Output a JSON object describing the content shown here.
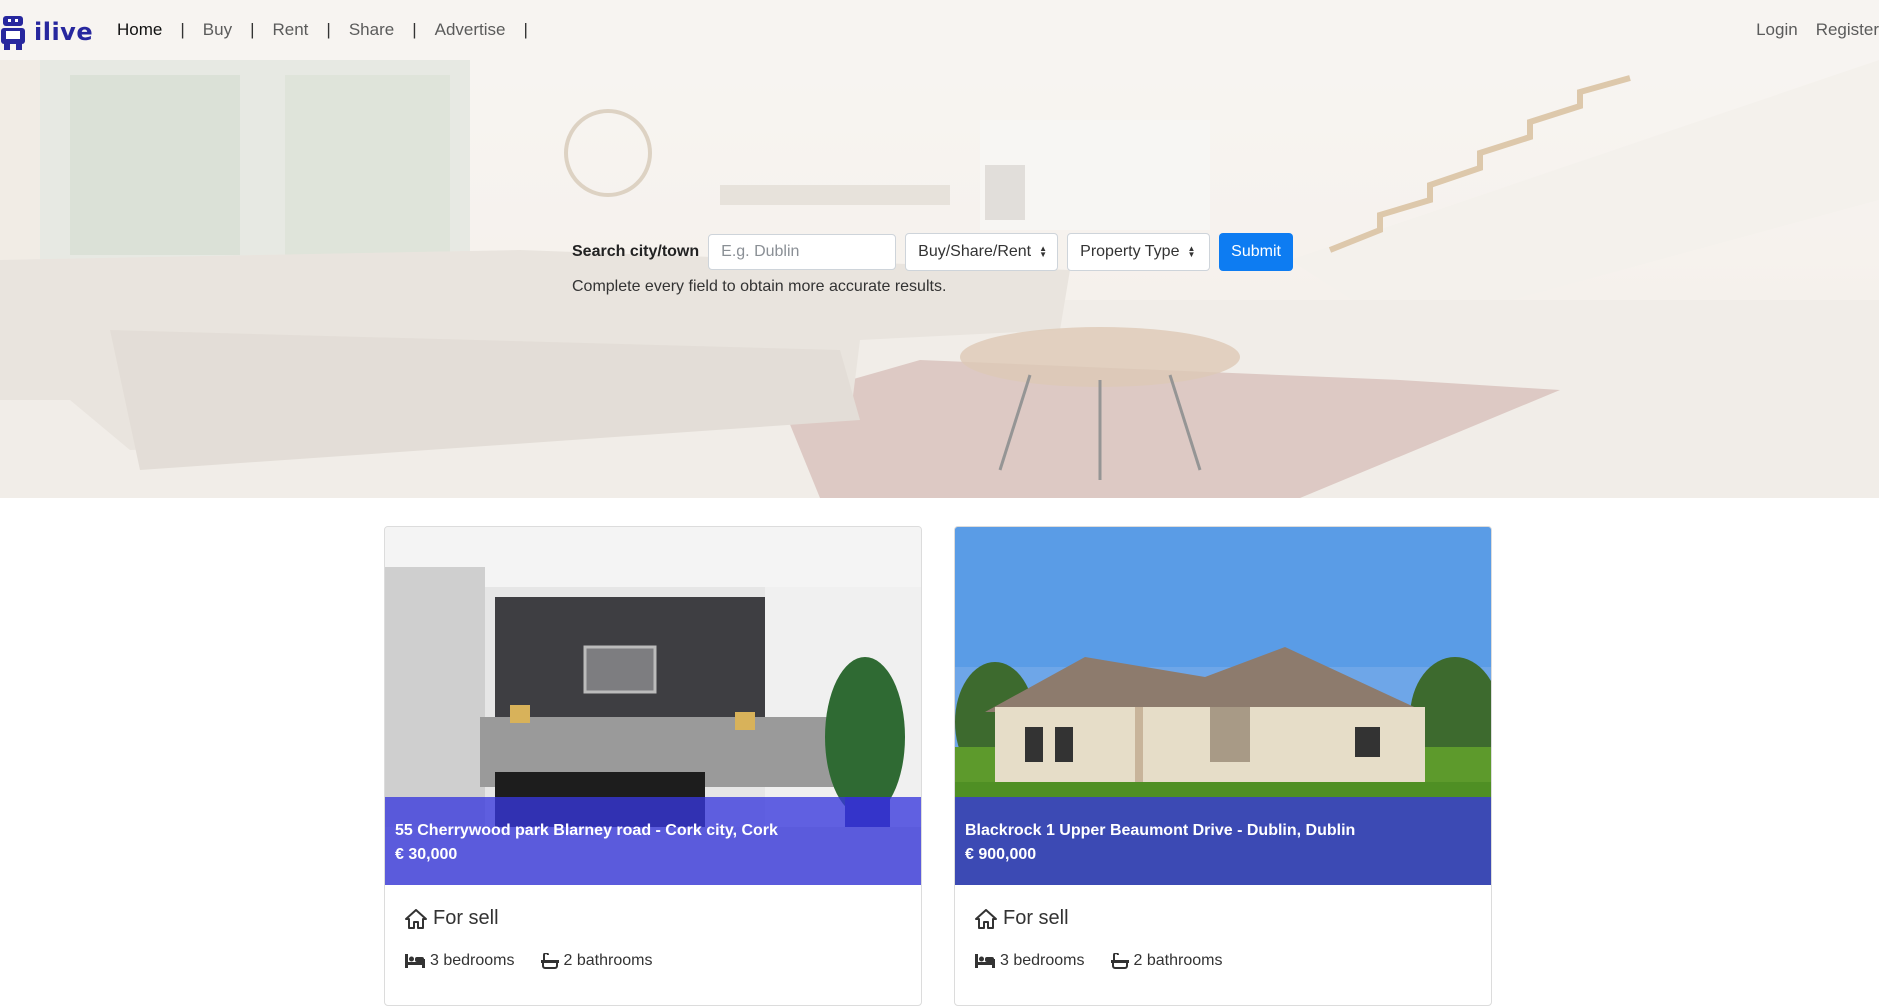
{
  "brand": {
    "name": "ilive",
    "color": "#27279e",
    "icon": "robot-logo-icon"
  },
  "nav": {
    "links": [
      {
        "label": "Home",
        "active": true
      },
      {
        "label": "Buy",
        "active": false
      },
      {
        "label": "Rent",
        "active": false
      },
      {
        "label": "Share",
        "active": false
      },
      {
        "label": "Advertise",
        "active": false
      }
    ],
    "separator": "|",
    "login_label": "Login",
    "register_label": "Register"
  },
  "search": {
    "label": "Search city/town",
    "placeholder": "E.g. Dublin",
    "mode_select": "Buy/Share/Rent",
    "type_select": "Property Type",
    "submit_label": "Submit",
    "hint": "Complete every field to obtain more accurate results.",
    "submit_color": "#0d7cf2"
  },
  "listings": [
    {
      "address": "55 Cherrywood park Blarney road - Cork city, Cork",
      "price": "€ 30,000",
      "status": "For sell",
      "bedrooms": "3 bedrooms",
      "bathrooms": "2 bathrooms",
      "status_icon": "home-icon",
      "bed_icon": "bed-icon",
      "bath_icon": "bath-icon"
    },
    {
      "address": "Blackrock 1 Upper Beaumont Drive - Dublin, Dublin",
      "price": "€ 900,000",
      "status": "For sell",
      "bedrooms": "3 bedrooms",
      "bathrooms": "2 bathrooms",
      "status_icon": "home-icon",
      "bed_icon": "bed-icon",
      "bath_icon": "bath-icon"
    }
  ],
  "colors": {
    "overlay": "rgba(55,55,220,0.78)",
    "hero_bg": "#f1ebe4"
  }
}
